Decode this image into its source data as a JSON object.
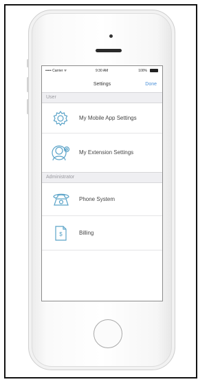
{
  "status_bar": {
    "carrier": "••••• Carrier ᯤ",
    "time": "9:30 AM",
    "battery": "100%"
  },
  "nav": {
    "title": "Settings",
    "done_label": "Done"
  },
  "sections": [
    {
      "header": "User",
      "items": [
        {
          "label": "My Mobile App Settings",
          "icon": "gear-icon"
        },
        {
          "label": "My Extension Settings",
          "icon": "user-settings-icon"
        }
      ]
    },
    {
      "header": "Administrator",
      "items": [
        {
          "label": "Phone System",
          "icon": "phone-icon"
        },
        {
          "label": "Billing",
          "icon": "dollar-document-icon"
        }
      ]
    }
  ],
  "colors": {
    "accent": "#4a90d9",
    "icon": "#5aa3c8"
  }
}
